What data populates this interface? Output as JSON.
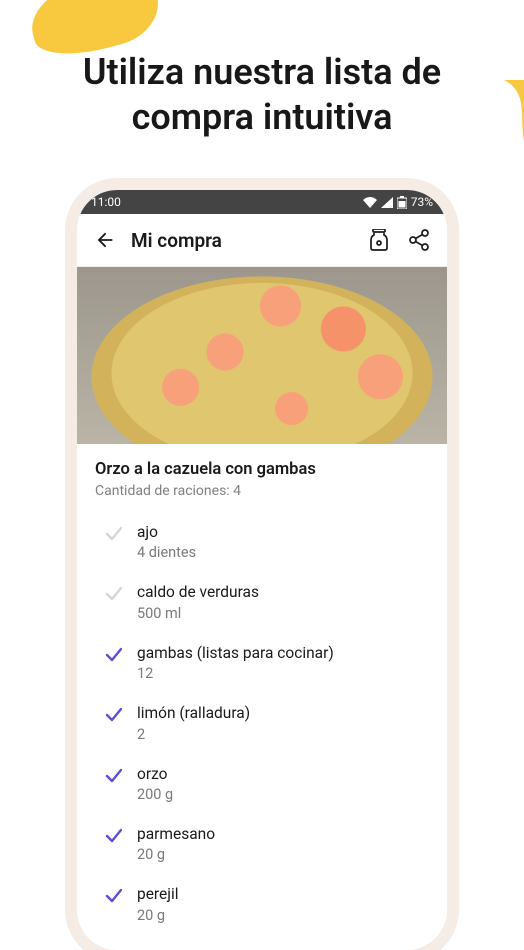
{
  "hero": {
    "title": "Utiliza nuestra lista de compra intuitiva"
  },
  "statusBar": {
    "time": "11:00",
    "battery": "73%"
  },
  "header": {
    "title": "Mi compra"
  },
  "recipe": {
    "title": "Orzo a la cazuela con gambas",
    "servings": "Cantidad de raciones: 4"
  },
  "ingredients": [
    {
      "name": "ajo",
      "qty": "4 dientes",
      "checked": false
    },
    {
      "name": "caldo de verduras",
      "qty": "500 ml",
      "checked": false
    },
    {
      "name": "gambas (listas para cocinar)",
      "qty": "12",
      "checked": true
    },
    {
      "name": "limón (ralladura)",
      "qty": "2",
      "checked": true
    },
    {
      "name": "orzo",
      "qty": "200 g",
      "checked": true
    },
    {
      "name": "parmesano",
      "qty": "20 g",
      "checked": true
    },
    {
      "name": "perejil",
      "qty": "20 g",
      "checked": true
    }
  ],
  "colors": {
    "checkedStroke": "#5b4fd6",
    "uncheckedStroke": "#d6d6d6"
  }
}
